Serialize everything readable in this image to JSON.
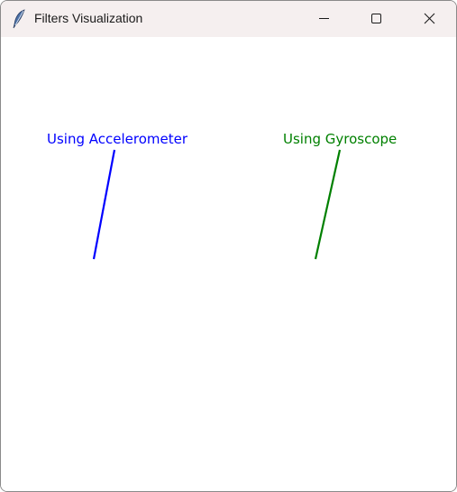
{
  "window": {
    "title": "Filters Visualization",
    "app_icon": "feather-icon",
    "controls": {
      "minimize_icon": "minimize-icon",
      "maximize_icon": "maximize-icon",
      "close_icon": "close-icon"
    }
  },
  "canvas": {
    "accelerometer": {
      "label": "Using Accelerometer",
      "color": "#0000ff"
    },
    "gyroscope": {
      "label": "Using Gyroscope",
      "color": "#008000"
    }
  }
}
